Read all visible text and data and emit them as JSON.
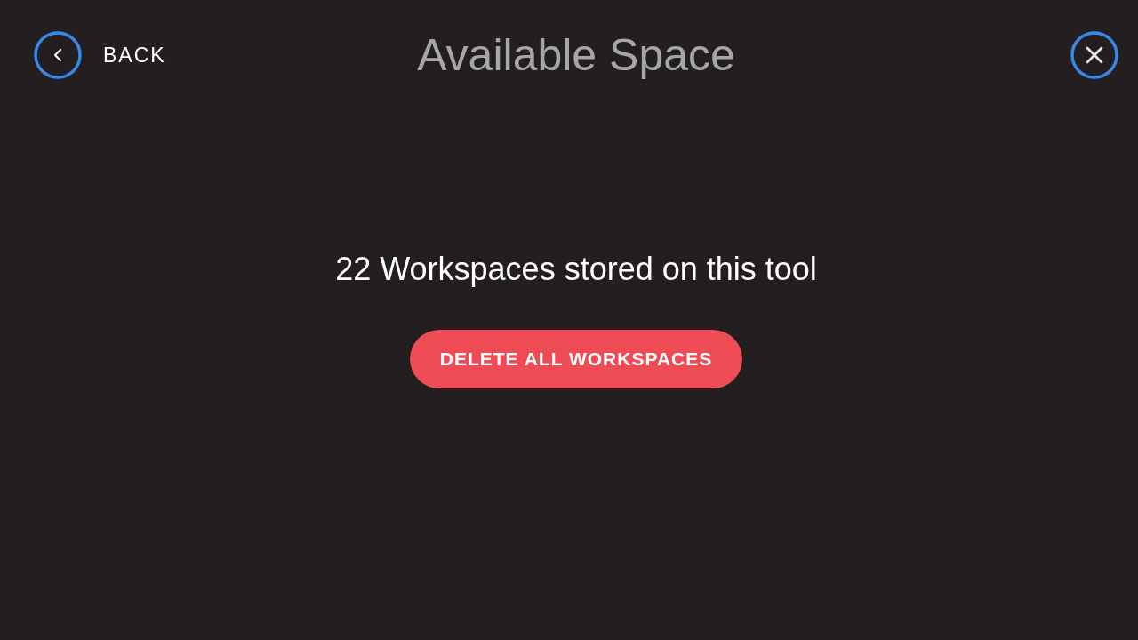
{
  "header": {
    "back_label": "BACK",
    "title": "Available Space"
  },
  "message": "22 Workspaces stored on this tool",
  "delete_button": {
    "label": "DELETE ALL WORKSPACES"
  }
}
